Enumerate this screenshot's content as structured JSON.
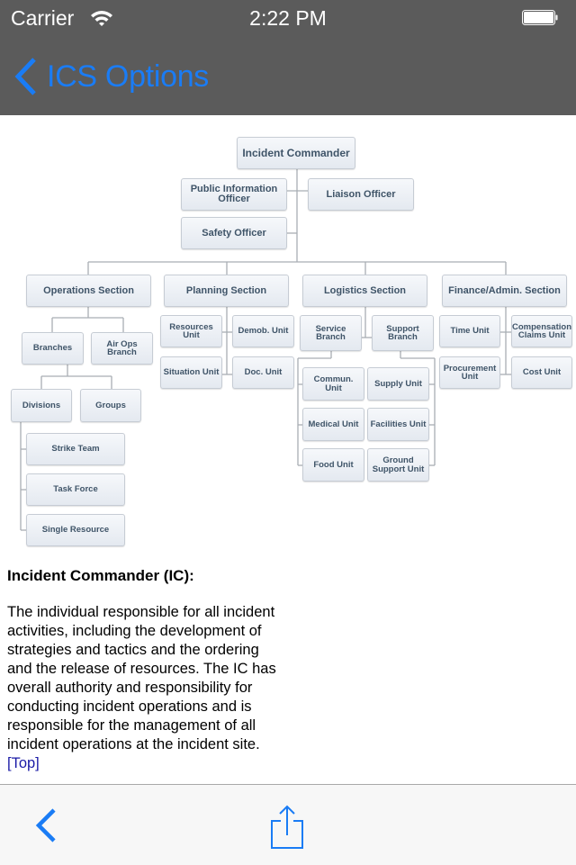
{
  "status_bar": {
    "carrier": "Carrier",
    "time": "2:22 PM",
    "icons": [
      "wifi-icon",
      "battery-icon"
    ]
  },
  "nav_bar": {
    "back_label": "ICS Options",
    "back_icon": "chevron-left-icon",
    "accent_color": "#1a7cf5"
  },
  "org_chart": {
    "command": {
      "commander": "Incident Commander",
      "public_information_officer": "Public Information Officer",
      "liaison_officer": "Liaison Officer",
      "safety_officer": "Safety Officer"
    },
    "sections": {
      "operations": {
        "label": "Operations Section",
        "branches": "Branches",
        "air_ops_branch": "Air Ops Branch",
        "divisions": "Divisions",
        "groups": "Groups",
        "strike_team": "Strike Team",
        "task_force": "Task Force",
        "single_resource": "Single Resource"
      },
      "planning": {
        "label": "Planning Section",
        "resources_unit": "Resources Unit",
        "demob_unit": "Demob. Unit",
        "situation_unit": "Situation Unit",
        "doc_unit": "Doc. Unit"
      },
      "logistics": {
        "label": "Logistics Section",
        "service_branch": "Service Branch",
        "support_branch": "Support Branch",
        "commun_unit": "Commun. Unit",
        "medical_unit": "Medical Unit",
        "food_unit": "Food Unit",
        "supply_unit": "Supply Unit",
        "facilities_unit": "Facilities Unit",
        "ground_support_unit": "Ground Support Unit"
      },
      "finance": {
        "label": "Finance/Admin. Section",
        "time_unit": "Time Unit",
        "compensation_claims_unit": "Compensation Claims Unit",
        "procurement_unit": "Procurement Unit",
        "cost_unit": "Cost Unit"
      }
    }
  },
  "content": {
    "title": "Incident Commander (IC):",
    "description": "The individual responsible for all incident activities, including the development of strategies and tactics and the ordering and the release of resources. The IC has overall authority and responsibility for conducting incident operations and is responsible for the management of all incident operations at the incident site.",
    "top_link": "[Top]"
  },
  "toolbar": {
    "back_icon": "chevron-left-icon",
    "share_icon": "share-icon"
  }
}
